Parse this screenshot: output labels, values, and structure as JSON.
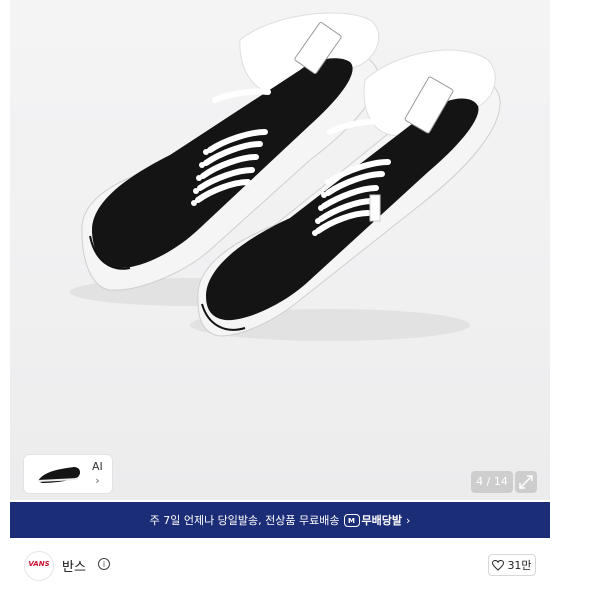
{
  "gallery": {
    "counter": "4 / 14",
    "thumbnail_label": "AI",
    "thumbnail_chevron": "›",
    "expand_icon": "expand-icon",
    "shoe_brand_text": "VANS",
    "colors": {
      "upper": "#141414",
      "laces": "#ffffff",
      "sole": "#f4f4f4",
      "background": "#f2f2f3"
    }
  },
  "banner": {
    "text": "주 7일 언제나 당일발송, 전상품 무료배송",
    "badge_icon": "M",
    "badge_label": "무배당발",
    "chevron": "›",
    "background": "#1c2d78"
  },
  "brand": {
    "name": "반스",
    "logo_text": "VANS",
    "info_icon": "i",
    "like_count": "31만",
    "like_icon": "heart-icon"
  }
}
